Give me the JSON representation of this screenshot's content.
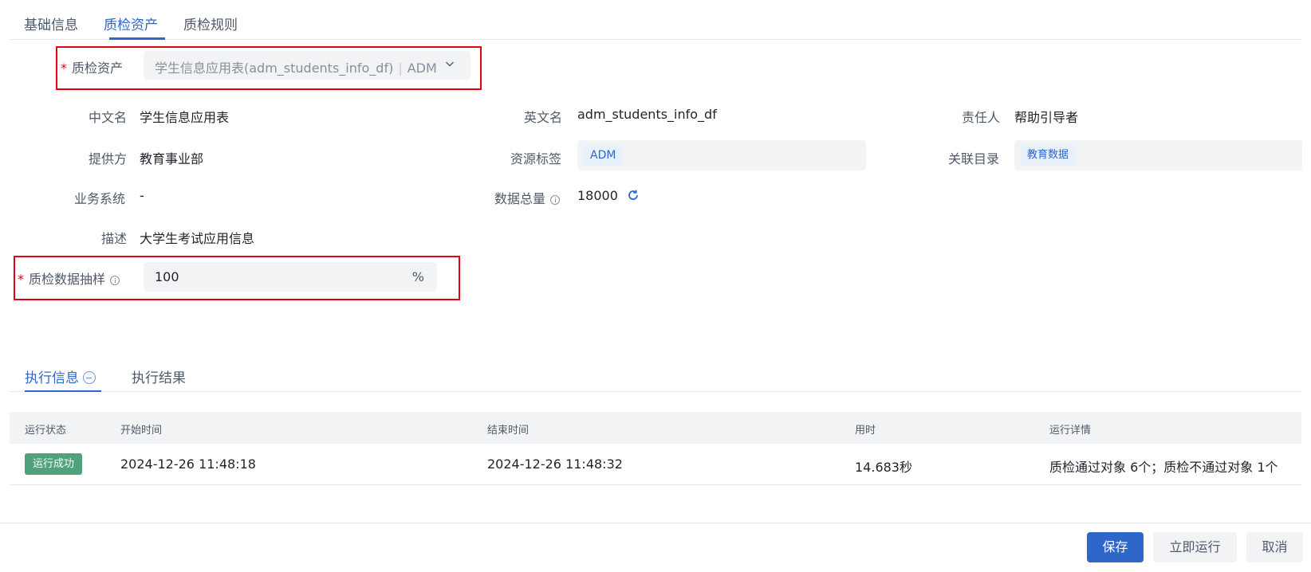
{
  "tabs": [
    {
      "label": "基础信息"
    },
    {
      "label": "质检资产"
    },
    {
      "label": "质检规则"
    }
  ],
  "asset": {
    "label": "质检资产",
    "required_mark": "*",
    "value": "学生信息应用表(adm_students_info_df)",
    "tag": "ADM"
  },
  "fields": {
    "cn_name": {
      "label": "中文名",
      "value": "学生信息应用表"
    },
    "en_name": {
      "label": "英文名",
      "value": "adm_students_info_df"
    },
    "owner": {
      "label": "责任人",
      "value": "帮助引导者"
    },
    "provider": {
      "label": "提供方",
      "value": "教育事业部"
    },
    "resource_tag": {
      "label": "资源标签",
      "value": "ADM"
    },
    "catalog": {
      "label": "关联目录",
      "value": "教育数据"
    },
    "biz_system": {
      "label": "业务系统",
      "value": "-"
    },
    "total": {
      "label": "数据总量",
      "value": "18000"
    },
    "description": {
      "label": "描述",
      "value": "大学生考试应用信息"
    }
  },
  "sampling": {
    "label": "质检数据抽样",
    "required_mark": "*",
    "value": "100",
    "unit": "%"
  },
  "exec_tabs": [
    {
      "label": "执行信息"
    },
    {
      "label": "执行结果"
    }
  ],
  "table": {
    "headers": [
      "运行状态",
      "开始时间",
      "结束时间",
      "用时",
      "运行详情"
    ],
    "rows": [
      {
        "status": "运行成功",
        "start": "2024-12-26 11:48:18",
        "end": "2024-12-26 11:48:32",
        "duration": "14.683秒",
        "detail": "质检通过对象 6个；质检不通过对象 1个"
      }
    ]
  },
  "buttons": {
    "save": "保存",
    "run_now": "立即运行",
    "cancel": "取消"
  },
  "colors": {
    "primary": "#2f66c9",
    "success": "#4fa27a",
    "highlight": "#e60012"
  }
}
